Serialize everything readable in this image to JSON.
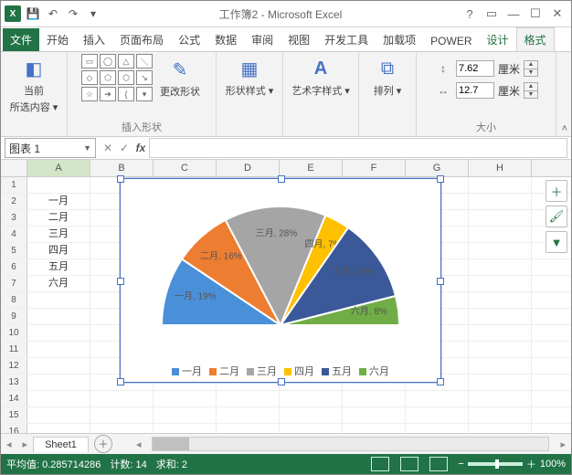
{
  "title": "工作簿2 - Microsoft Excel",
  "tabs": {
    "file": "文件",
    "items": [
      "开始",
      "插入",
      "页面布局",
      "公式",
      "数据",
      "审阅",
      "视图",
      "开发工具",
      "加载项",
      "POWER"
    ],
    "ctx": [
      "设计",
      "格式"
    ],
    "active": "格式"
  },
  "ribbon": {
    "cur_sel_top": "当前",
    "cur_sel_bottom": "所选内容",
    "insert_shapes": "插入形状",
    "change_shape": "更改形状",
    "shape_styles": "形状样式",
    "wordart_styles": "艺术字样式",
    "arrange": "排列",
    "size": "大小",
    "height": "7.62",
    "width": "12.7",
    "unit": "厘米"
  },
  "namebox": "图表 1",
  "columns": [
    "A",
    "B",
    "C",
    "D",
    "E",
    "F",
    "G",
    "H"
  ],
  "row_count": 16,
  "cells": {
    "A1": "",
    "A2": "一月",
    "A3": "二月",
    "A4": "三月",
    "A5": "四月",
    "A6": "五月",
    "A7": "六月"
  },
  "chart_data": {
    "type": "pie",
    "variant": "half-donut",
    "categories": [
      "一月",
      "二月",
      "三月",
      "四月",
      "五月",
      "六月"
    ],
    "values": [
      19,
      16,
      28,
      7,
      23,
      8
    ],
    "labels": [
      "一月, 19%",
      "二月, 16%",
      "三月, 28%",
      "四月, 7%",
      "五月, 23%",
      "六月, 8%"
    ],
    "colors": [
      "#4a90d9",
      "#ed7d31",
      "#a5a5a5",
      "#ffc000",
      "#3b5998",
      "#70ad47"
    ],
    "legend_position": "bottom"
  },
  "sheet_tab": "Sheet1",
  "status": {
    "avg_label": "平均值:",
    "avg": "0.285714286",
    "count_label": "计数:",
    "count": "14",
    "sum_label": "求和:",
    "sum": "2",
    "zoom": "100%"
  }
}
